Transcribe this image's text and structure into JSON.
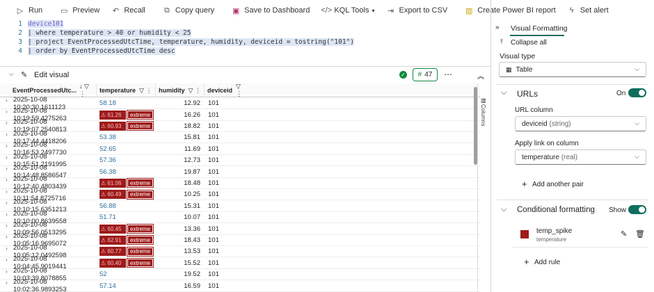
{
  "toolbar": {
    "run": "Run",
    "preview": "Preview",
    "recall": "Recall",
    "copy_query": "Copy query",
    "save_dashboard": "Save to Dashboard",
    "kql_tools": "KQL Tools",
    "export_csv": "Export to CSV",
    "power_bi": "Create Power BI report",
    "set_alert": "Set alert"
  },
  "editor": {
    "lines": [
      {
        "n": "1",
        "text": "device101"
      },
      {
        "n": "2",
        "text": "| where temperature > 40 or humidity < 25"
      },
      {
        "n": "3",
        "text": "| project EventProcessedUtcTime, temperature, humidity, deviceid = tostring(\"101\")"
      },
      {
        "n": "4",
        "text": "| order by EventProcessedUtcTime desc"
      }
    ]
  },
  "grid": {
    "edit_visual": "Edit visual",
    "count": "47",
    "columns_label": "Columns",
    "headers": [
      "EventProcessedUtc...",
      "temperature",
      "humidity",
      "deviceid"
    ],
    "rows": [
      [
        "2025-10-08 10:20:30.1611123",
        "58.18",
        "12.92",
        "101",
        false
      ],
      [
        "2025-10-08 10:19:59.4275263",
        "61.26",
        "16.26",
        "101",
        true
      ],
      [
        "2025-10-08 10:19:07.2540813",
        "60.93",
        "18.82",
        "101",
        true
      ],
      [
        "2025-10-08 10:17:44.4418206",
        "53.38",
        "15.81",
        "101",
        false
      ],
      [
        "2025-10-08 10:16:53.2497730",
        "52.65",
        "11.69",
        "101",
        false
      ],
      [
        "2025-10-08 10:15:51.2191995",
        "57.36",
        "12.73",
        "101",
        false
      ],
      [
        "2025-10-08 10:14:48.8586547",
        "56.38",
        "19.87",
        "101",
        false
      ],
      [
        "2025-10-08 10:12:40.4803439",
        "61.06",
        "18.48",
        "101",
        true
      ],
      [
        "2025-10-08 10:11:54.8725716",
        "60.49",
        "10.25",
        "101",
        true
      ],
      [
        "2025-10-08 10:10:15.6351213",
        "56.88",
        "15.31",
        "101",
        false
      ],
      [
        "2025-10-08 10:10:00.8639558",
        "51.71",
        "10.07",
        "101",
        false
      ],
      [
        "2025-10-08 10:09:56.0513295",
        "60.45",
        "13.36",
        "101",
        true
      ],
      [
        "2025-10-08 10:05:16.9695072",
        "62.91",
        "18.43",
        "101",
        true
      ],
      [
        "2025-10-08 10:05:12.0492598",
        "60.77",
        "13.53",
        "101",
        true
      ],
      [
        "2025-10-08 10:04:45.9019441",
        "60.40",
        "15.52",
        "101",
        true
      ],
      [
        "2025-10-08 10:03:39.8078855",
        "52",
        "19.52",
        "101",
        false
      ],
      [
        "2025-10-08 10:02:36.9893253",
        "57.14",
        "16.59",
        "101",
        false
      ]
    ],
    "extreme_label": "extreme"
  },
  "panel": {
    "title": "Visual Formatting",
    "collapse_all": "Collapse all",
    "visual_type_label": "Visual type",
    "visual_type_value": "Table",
    "urls_label": "URLs",
    "urls_toggle": "On",
    "url_column_label": "URL column",
    "url_column_value": "deviceid",
    "url_column_type": "(string)",
    "apply_link_label": "Apply link on column",
    "apply_link_value": "temperature",
    "apply_link_type": "(real)",
    "add_pair": "Add another pair",
    "cond_label": "Conditional formatting",
    "cond_toggle": "Show",
    "rule_name": "temp_spike",
    "rule_column": "temperature",
    "add_rule": "Add rule"
  },
  "colors": {
    "accent": "#0f6e5e",
    "extreme": "#9d1b1b"
  }
}
